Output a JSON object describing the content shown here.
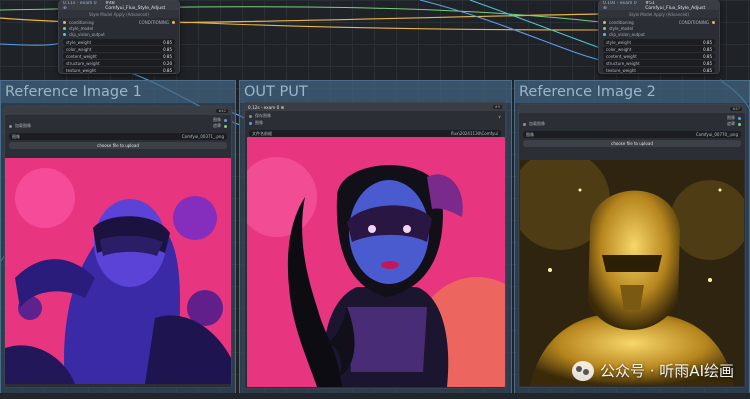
{
  "colors": {
    "wire_cond": "#e8b54a",
    "wire_blue": "#5aa0e6",
    "wire_green": "#7bd07b",
    "wire_teal": "#4ec9d6",
    "group": "#3f6a8c"
  },
  "node_left": {
    "badge": "0.11s - exam 0 ⊕",
    "title": "#48 Comfyui_Flux_Style_Adjust",
    "sub": "Style Model Apply (Advanced)",
    "in1": "conditioning",
    "in2": "style_model",
    "in3": "clip_vision_output",
    "out1": "CONDITIONING",
    "w": [
      {
        "label": "style_weight",
        "value": "0.85"
      },
      {
        "label": "color_weight",
        "value": "0.85"
      },
      {
        "label": "content_weight",
        "value": "0.85"
      },
      {
        "label": "structure_weight",
        "value": "0.20"
      },
      {
        "label": "texture_weight",
        "value": "0.85"
      }
    ]
  },
  "node_right": {
    "badge": "0.10s - exam 0 ⊕",
    "title": "#51 Comfyui_Flux_Style_Adjust",
    "sub": "Style Model Apply (Advanced)",
    "in1": "conditioning",
    "in2": "style_model",
    "in3": "clip_vision_output",
    "out1": "CONDITIONING",
    "w": [
      {
        "label": "style_weight",
        "value": "0.85"
      },
      {
        "label": "color_weight",
        "value": "0.85"
      },
      {
        "label": "content_weight",
        "value": "0.85"
      },
      {
        "label": "structure_weight",
        "value": "0.85"
      },
      {
        "label": "texture_weight",
        "value": "0.85"
      }
    ]
  },
  "groups": {
    "ref1": "Reference Image 1",
    "out": "OUT PUT",
    "ref2": "Reference Image 2"
  },
  "load1": {
    "title": "加载图像",
    "badge": "#42",
    "out_image": "图像",
    "out_mask": "遮罩",
    "image_label": "图像",
    "image_value": "Comfyui_00371_.png",
    "upload": "choose file to upload"
  },
  "save": {
    "badge": "0.12s - exam 0 ⊕",
    "title": "保存图像",
    "badge2": "#9",
    "in_image": "图像",
    "prefix_label": "文件名前缀",
    "prefix_value": "flux\\20241130\\Comfyui"
  },
  "load2": {
    "title": "加载图像",
    "badge": "#47",
    "out_image": "图像",
    "out_mask": "遮罩",
    "image_label": "图像",
    "image_value": "Comfyui_00770_.png",
    "upload": "choose file to upload"
  },
  "watermark": "公众号 · 听雨AI绘画"
}
